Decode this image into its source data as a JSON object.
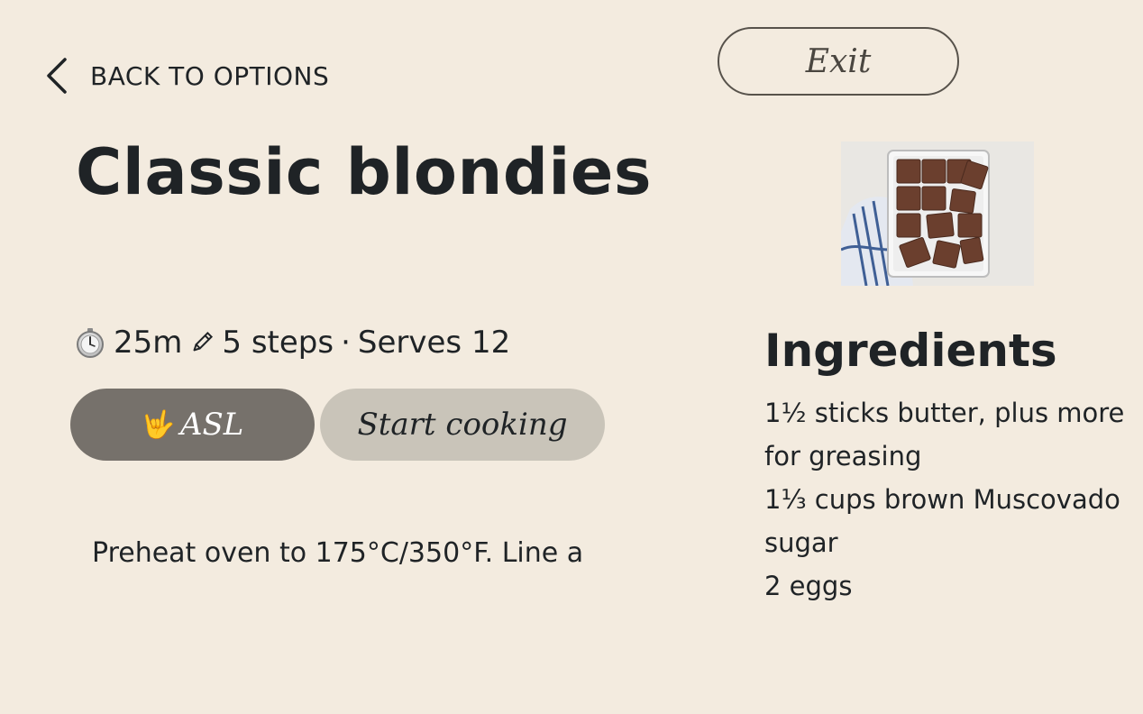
{
  "nav": {
    "back_label": "BACK TO OPTIONS",
    "exit_label": "Exit"
  },
  "recipe": {
    "title": "Classic blondies",
    "time": "25m",
    "steps": "5 steps",
    "separator": "·",
    "serves": "Serves 12",
    "timer_icon": "stopwatch-icon",
    "steps_icon": "pencil-icon"
  },
  "actions": {
    "asl_icon": "🤟",
    "asl_label": "ASL",
    "start_label": "Start cooking"
  },
  "step_preview": "Preheat oven to 175°C/350°F. Line a",
  "ingredients": {
    "title": "Ingredients",
    "items": [
      "1½ sticks butter, plus more for greasing",
      "1⅓ cups brown Muscovado sugar",
      "2 eggs"
    ]
  },
  "colors": {
    "background": "#f3ebdf",
    "asl_button": "#76716b",
    "start_button": "#c9c4b9",
    "text": "#1f2326"
  }
}
